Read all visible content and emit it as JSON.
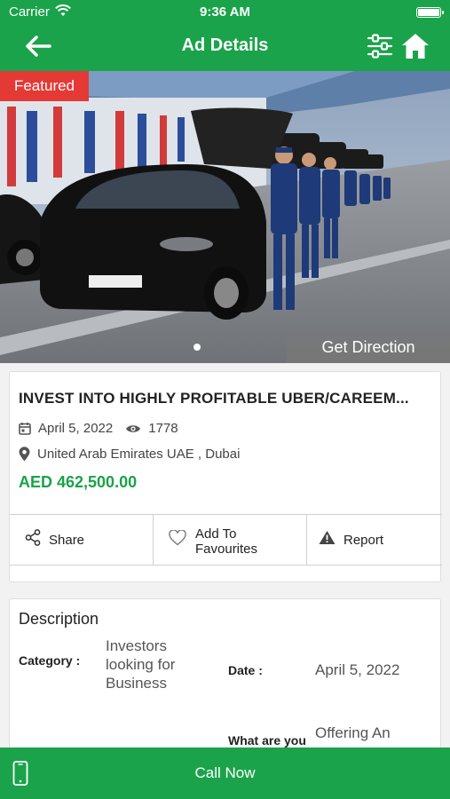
{
  "status_bar": {
    "carrier": "Carrier",
    "time": "9:36 AM"
  },
  "nav": {
    "title": "Ad Details",
    "back_icon": "arrow-left-icon",
    "filter_icon": "sliders-icon",
    "home_icon": "home-icon"
  },
  "hero": {
    "badge": "Featured",
    "get_direction": "Get Direction",
    "slide_count": 1,
    "active_slide": 1
  },
  "ad": {
    "title": "INVEST INTO HIGHLY PROFITABLE UBER/CAREEM...",
    "date": "April 5, 2022",
    "views": "1778",
    "location": "United Arab Emirates UAE , Dubai",
    "price": "AED 462,500.00"
  },
  "actions": {
    "share": "Share",
    "favourite_line1": "Add To",
    "favourite_line2": "Favourites",
    "report": "Report"
  },
  "description": {
    "heading": "Description",
    "category_label": "Category :",
    "category_line1": "Investors",
    "category_line2": "looking for",
    "category_line3": "Business",
    "date_label": "Date :",
    "date_value": "April 5, 2022",
    "what_label": "What are you",
    "what_value": "Offering An"
  },
  "call_now": "Call Now",
  "colors": {
    "brand_green": "#1aa34a",
    "featured_red": "#e53935"
  }
}
